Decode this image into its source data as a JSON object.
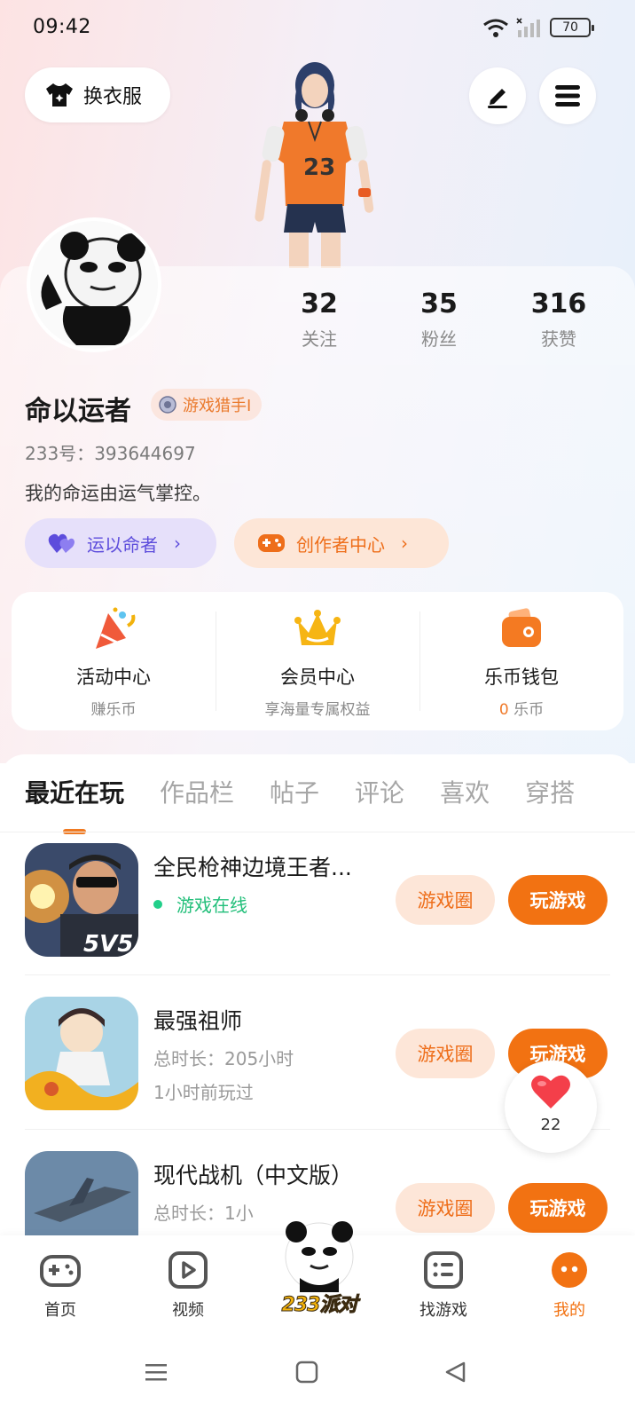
{
  "status_bar": {
    "time": "09:42",
    "battery": "70"
  },
  "header": {
    "outfit_label": "换衣服"
  },
  "stats": [
    {
      "value": "32",
      "label": "关注"
    },
    {
      "value": "35",
      "label": "粉丝"
    },
    {
      "value": "316",
      "label": "获赞"
    }
  ],
  "profile": {
    "username": "命以运者",
    "badge": "游戏猎手I",
    "id_label": "233号：",
    "id_value": "393644697",
    "bio": "我的命运由运气掌控。"
  },
  "pills": {
    "fate_label": "运以命者",
    "creator_label": "创作者中心"
  },
  "services": [
    {
      "title": "活动中心",
      "subtitle": "赚乐币"
    },
    {
      "title": "会员中心",
      "subtitle": "享海量专属权益"
    },
    {
      "title": "乐币钱包",
      "subtitle_num": "0",
      "subtitle_unit": " 乐币"
    }
  ],
  "tabs": [
    "最近在玩",
    "作品栏",
    "帖子",
    "评论",
    "喜欢",
    "穿搭"
  ],
  "games": [
    {
      "name": "全民枪神边境王者...",
      "status": "游戏在线",
      "circle_label": "游戏圈",
      "play_label": "玩游戏"
    },
    {
      "name": "最强祖师",
      "duration": "总时长：205小时",
      "last_played": "1小时前玩过",
      "circle_label": "游戏圈",
      "play_label": "玩游戏"
    },
    {
      "name": "现代战机（中文版）",
      "duration": "总时长：1小",
      "circle_label": "游戏圈",
      "play_label": "玩游戏"
    }
  ],
  "like_float": {
    "count": "22"
  },
  "bottom_nav": {
    "home": "首页",
    "video": "视频",
    "center": "233派对",
    "find": "找游戏",
    "mine": "我的"
  },
  "colors": {
    "accent": "#f27212",
    "purple": "#5d4ddc",
    "online": "#22bf7a"
  }
}
